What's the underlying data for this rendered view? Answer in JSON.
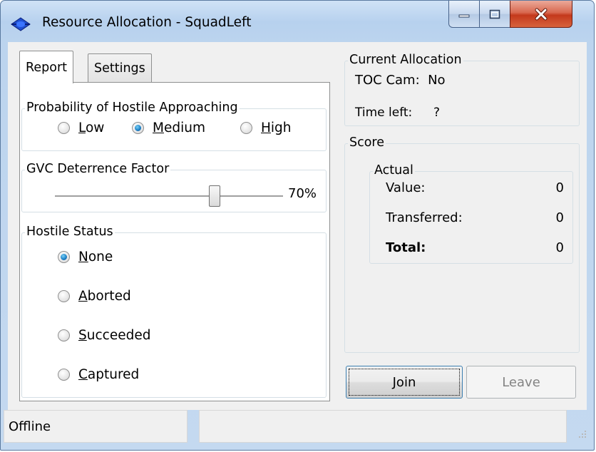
{
  "window": {
    "title": "Resource Allocation - SquadLeft",
    "icon": "blue-diamond-app-icon",
    "colors": {
      "title_bg": "#b7d1ee",
      "close_red": "#c4391c",
      "focus_blue": "#3c7fb1"
    }
  },
  "tabs": [
    {
      "label": "Report",
      "active": true
    },
    {
      "label": "Settings",
      "active": false
    }
  ],
  "probability": {
    "title": "Probability of Hostile Approaching",
    "options": [
      {
        "label": "Low",
        "checked": false
      },
      {
        "label": "Medium",
        "checked": true
      },
      {
        "label": "High",
        "checked": false
      }
    ]
  },
  "deterrence": {
    "title": "GVC Deterrence Factor",
    "value_label": "70%",
    "value": 0.7
  },
  "hostile_status": {
    "title": "Hostile Status",
    "options": [
      {
        "label": "None",
        "checked": true
      },
      {
        "label": "Aborted",
        "checked": false
      },
      {
        "label": "Succeeded",
        "checked": false
      },
      {
        "label": "Captured",
        "checked": false
      }
    ]
  },
  "current_allocation": {
    "title": "Current Allocation",
    "toc_cam": "TOC Cam:  No",
    "time_left_label": "Time left:",
    "time_left_value": "?"
  },
  "score": {
    "title": "Score",
    "actual_title": "Actual",
    "rows": [
      {
        "label": "Value:",
        "value": "0",
        "bold": false
      },
      {
        "label": "Transferred:",
        "value": "0",
        "bold": false
      },
      {
        "label": "Total:",
        "value": "0",
        "bold": true
      }
    ]
  },
  "buttons": {
    "join": "Join",
    "leave": "Leave"
  },
  "status": {
    "connection": "Offline",
    "message": ""
  }
}
